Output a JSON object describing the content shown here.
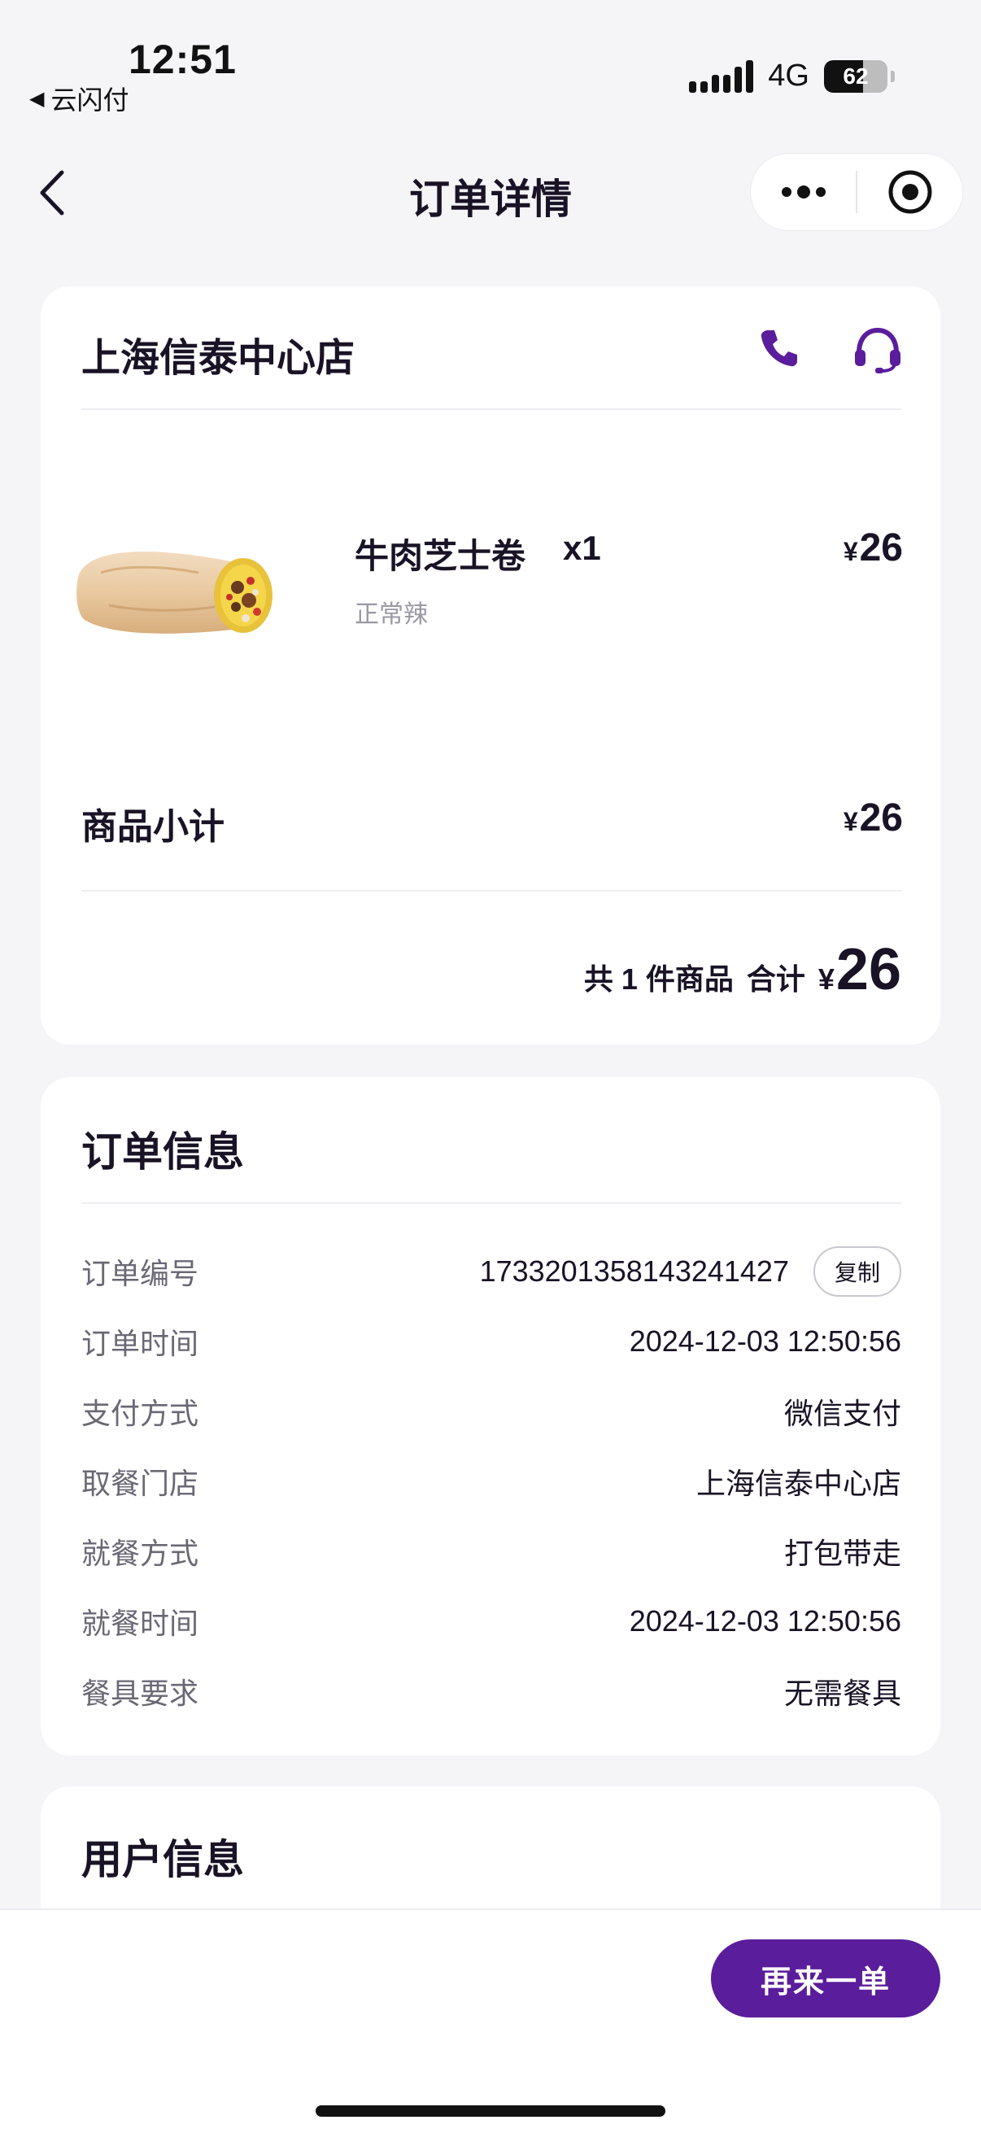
{
  "status_bar": {
    "time": "12:51",
    "back_app": "云闪付",
    "network": "4G",
    "battery_text": "62",
    "battery_level": 0.62
  },
  "nav": {
    "title": "订单详情",
    "more_icon": "more-dots-icon",
    "close_icon": "target-circle-icon"
  },
  "store": {
    "name": "上海信泰中心店",
    "icons": [
      "phone-icon",
      "headset-icon"
    ],
    "accent_color": "#5a1d9c"
  },
  "product": {
    "name": "牛肉芝士卷",
    "qty": "x1",
    "spec": "正常辣",
    "currency": "¥",
    "price": "26",
    "image": "burrito-image"
  },
  "summary": {
    "subtotal_label": "商品小计",
    "subtotal_currency": "¥",
    "subtotal_value": "26",
    "count_text": "共 1 件商品",
    "total_label": "合计",
    "total_currency": "¥",
    "total_value": "26"
  },
  "order_info": {
    "title": "订单信息",
    "copy_label": "复制",
    "rows": [
      {
        "label": "订单编号",
        "value": "1733201358143241427"
      },
      {
        "label": "订单时间",
        "value": "2024-12-03 12:50:56"
      },
      {
        "label": "支付方式",
        "value": "微信支付"
      },
      {
        "label": "取餐门店",
        "value": "上海信泰中心店"
      },
      {
        "label": "就餐方式",
        "value": "打包带走"
      },
      {
        "label": "就餐时间",
        "value": "2024-12-03 12:50:56"
      },
      {
        "label": "餐具要求",
        "value": "无需餐具"
      }
    ]
  },
  "user_info": {
    "title": "用户信息"
  },
  "bottom": {
    "reorder_label": "再来一单",
    "button_color": "#5a1d9c"
  }
}
